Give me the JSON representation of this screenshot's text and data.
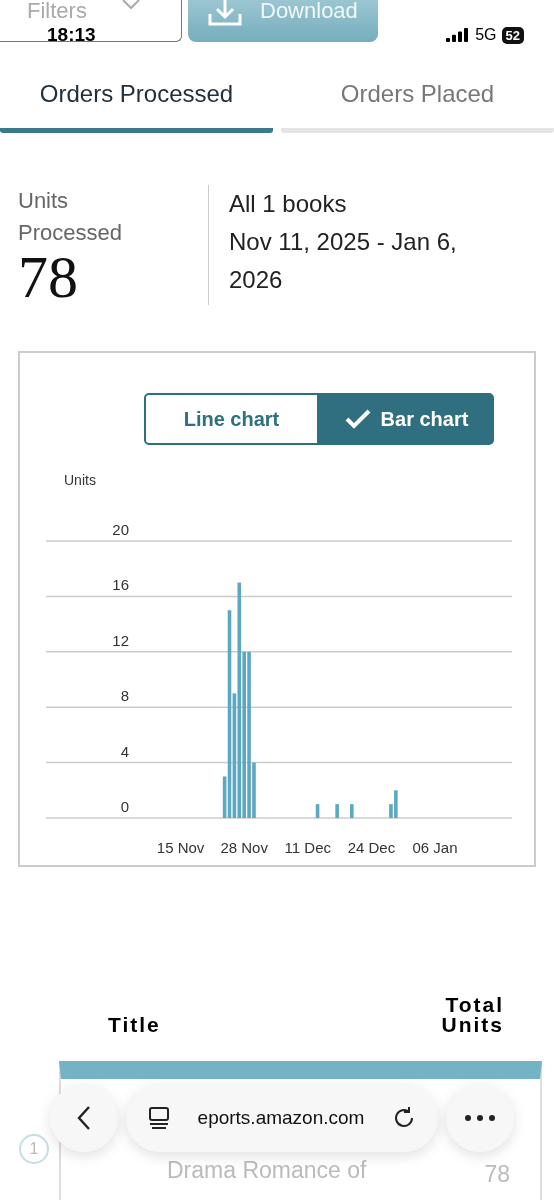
{
  "status_bar": {
    "time": "18:13",
    "network": "5G",
    "battery": "52"
  },
  "toolbar": {
    "filter": {
      "label": "Filters"
    },
    "download": {
      "label": "Download"
    }
  },
  "tabs": [
    {
      "label": "Orders Processed",
      "selected": true
    },
    {
      "label": "Orders Placed",
      "selected": false
    }
  ],
  "summary": {
    "label": "Units Processed",
    "value": "78",
    "scope": "All 1 books",
    "date_range": "Nov 11, 2025 - Jan 6, 2026"
  },
  "chart_toggle": [
    {
      "label": "Line chart",
      "selected": false
    },
    {
      "label": "Bar chart",
      "selected": true
    }
  ],
  "chart": {
    "chart_data": {
      "type": "bar",
      "ylabel": "Units",
      "categories": [
        null,
        null,
        null,
        null,
        "15 Nov",
        null,
        null,
        null,
        null,
        null,
        null,
        null,
        null,
        null,
        null,
        null,
        null,
        "28 Nov",
        null,
        null,
        null,
        null,
        null,
        null,
        null,
        null,
        null,
        null,
        null,
        null,
        "11 Dec",
        null,
        null,
        null,
        null,
        null,
        null,
        null,
        null,
        null,
        null,
        null,
        null,
        "24 Dec",
        null,
        null,
        null,
        null,
        null,
        null,
        null,
        null,
        null,
        null,
        null,
        null,
        "06 Jan"
      ],
      "series": [
        {
          "color": "#5ba8c0",
          "values": [
            0,
            0,
            0,
            0,
            0,
            0,
            0,
            0,
            0,
            0,
            0,
            0,
            0,
            3,
            15,
            9,
            17,
            12,
            12,
            4,
            0,
            0,
            0,
            0,
            0,
            0,
            0,
            0,
            0,
            0,
            0,
            0,
            1,
            0,
            0,
            0,
            1,
            0,
            0,
            1,
            0,
            0,
            0,
            0,
            0,
            0,
            0,
            1,
            2,
            0,
            0,
            0,
            0,
            0,
            0,
            0,
            0
          ]
        }
      ],
      "ylim": [
        0,
        20
      ],
      "grid": true,
      "yticks": [
        0,
        4,
        8,
        12,
        16,
        20
      ]
    }
  },
  "table": {
    "columns": [
      "Title",
      "Total Units"
    ],
    "rows": [
      {
        "rank": "1",
        "title": "Drama Romance of",
        "total": "78"
      }
    ]
  },
  "browser_bar": {
    "url": "eports.amazon.com"
  }
}
